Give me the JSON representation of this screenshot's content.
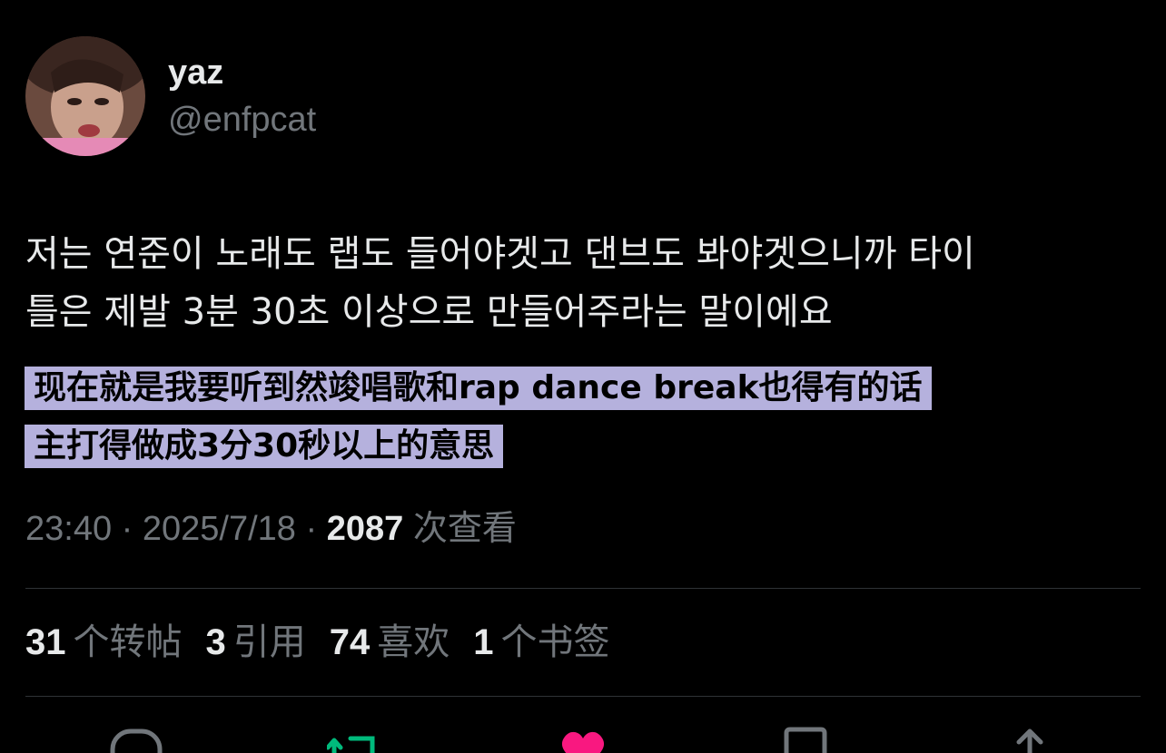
{
  "author": {
    "display_name": "yaz",
    "handle": "@enfpcat"
  },
  "tweet": {
    "text_line1": "저는 연준이 노래도 랩도 들어야겟고 댄브도 봐야겟으니까 타이",
    "text_line2": "틀은 제발 3분 30초 이상으로 만들어주라는 말이에요",
    "translation_line1": "现在就是我要听到然竣唱歌和rap dance break也得有的话",
    "translation_line2": "主打得做成3分30秒以上的意思",
    "time": "23:40",
    "separator": " · ",
    "date": "2025/7/18",
    "views": "2087",
    "views_label": "次查看"
  },
  "stats": {
    "retweets_count": "31",
    "retweets_label": "个转帖",
    "quotes_count": "3",
    "quotes_label": "引用",
    "likes_count": "74",
    "likes_label": "喜欢",
    "bookmarks_count": "1",
    "bookmarks_label": "个书签"
  },
  "colors": {
    "background": "#000000",
    "text": "#e7e9ea",
    "muted": "#71767b",
    "highlight": "#b5b1dd",
    "retweet": "#00ba7c",
    "like": "#f91880"
  },
  "icons": [
    "reply-icon",
    "retweet-icon",
    "like-icon",
    "bookmark-icon",
    "share-icon"
  ]
}
